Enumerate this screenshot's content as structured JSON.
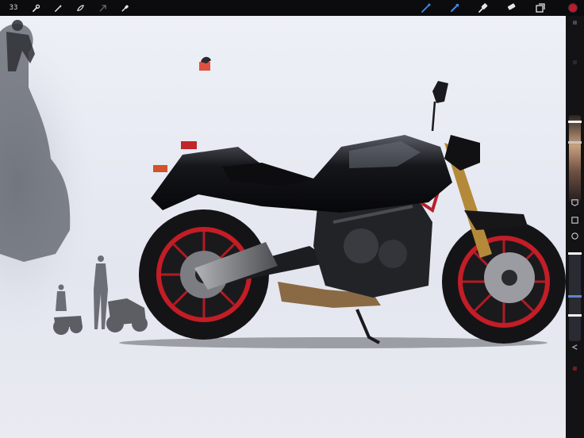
{
  "toolbar": {
    "gallery_label": "ЗЗ",
    "left_tools": [
      {
        "icon": "wrench-icon"
      },
      {
        "icon": "magic-wand-icon"
      },
      {
        "icon": "selection-icon"
      },
      {
        "icon": "transform-arrow-icon"
      },
      {
        "icon": "eyedropper-icon"
      }
    ],
    "right_tools": [
      {
        "icon": "brush-icon",
        "active": true
      },
      {
        "icon": "smudge-icon",
        "active": true
      },
      {
        "icon": "eraser-icon"
      },
      {
        "icon": "layers-icon"
      }
    ],
    "active_color": "#c0192c",
    "accent": "#3f8fe8"
  },
  "canvas": {
    "artwork": "motorcycle-illustration"
  },
  "sidebar": {
    "brush_size": 0.25,
    "brush_opacity": 0.22
  }
}
